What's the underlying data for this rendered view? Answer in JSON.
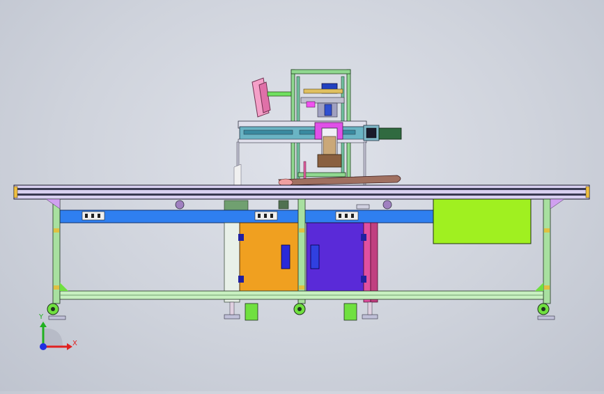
{
  "viewport": {
    "background": "#cfd3dc"
  },
  "triad": {
    "x_label": "X",
    "y_label": "Y",
    "x_color": "#e02020",
    "y_color": "#20b020",
    "origin_color": "#2030e0"
  },
  "palette": {
    "rail": "#3a3a52",
    "rail_top": "#d8d0f0",
    "blue_beam": "#2f7ff0",
    "leg": "#a8e0a0",
    "orange_panel": "#f0a020",
    "purple_panel": "#5a2ad8",
    "green_box": "#a0f020",
    "magenta": "#e040e0",
    "pink_disc": "#f080b0",
    "teal_slide": "#60b0c0"
  },
  "icons": [
    "view-triad-icon",
    "caster-wheel-icon",
    "leveling-foot-icon"
  ]
}
